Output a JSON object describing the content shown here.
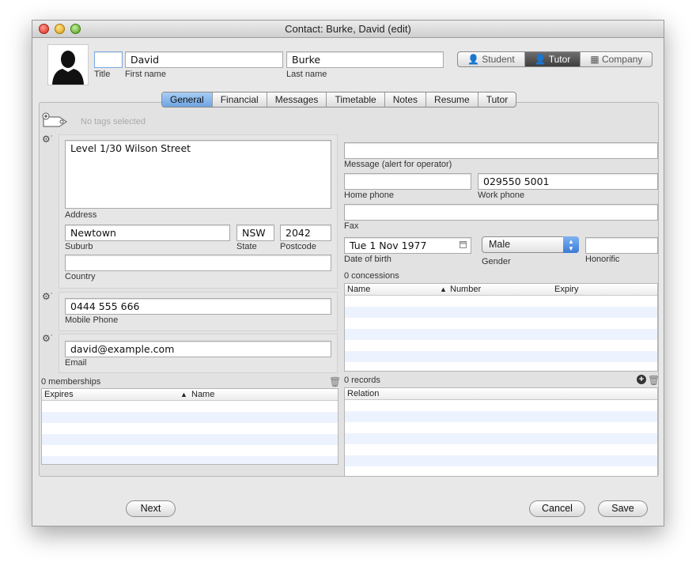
{
  "window": {
    "title": "Contact: Burke, David (edit)"
  },
  "header": {
    "title_value": "",
    "title_label": "Title",
    "first_name_value": "David",
    "first_name_label": "First name",
    "last_name_value": "Burke",
    "last_name_label": "Last name",
    "roles": [
      {
        "label": "Student",
        "active": false
      },
      {
        "label": "Tutor",
        "active": true
      },
      {
        "label": "Company",
        "active": false
      }
    ]
  },
  "tabs": [
    {
      "label": "General",
      "active": true
    },
    {
      "label": "Financial",
      "active": false
    },
    {
      "label": "Messages",
      "active": false
    },
    {
      "label": "Timetable",
      "active": false
    },
    {
      "label": "Notes",
      "active": false
    },
    {
      "label": "Resume",
      "active": false
    },
    {
      "label": "Tutor",
      "active": false
    }
  ],
  "tags": {
    "placeholder": "No tags selected"
  },
  "address": {
    "address_value": "Level 1/30 Wilson Street",
    "address_label": "Address",
    "suburb_value": "Newtown",
    "suburb_label": "Suburb",
    "state_value": "NSW",
    "state_label": "State",
    "postcode_value": "2042",
    "postcode_label": "Postcode",
    "country_value": "",
    "country_label": "Country"
  },
  "mobile": {
    "value": "0444 555 666",
    "label": "Mobile Phone"
  },
  "email": {
    "value": "david@example.com",
    "label": "Email"
  },
  "memberships": {
    "count_label": "0 memberships",
    "columns": [
      "Expires",
      "Name"
    ],
    "sort_indicator": "▲"
  },
  "right": {
    "message_value": "",
    "message_label": "Message (alert for operator)",
    "home_phone_value": "",
    "home_phone_label": "Home phone",
    "work_phone_value": "029550 5001",
    "work_phone_label": "Work phone",
    "fax_value": "",
    "fax_label": "Fax",
    "dob_value": "Tue 1 Nov 1977",
    "dob_label": "Date of birth",
    "gender_value": "Male",
    "gender_label": "Gender",
    "honorific_value": "",
    "honorific_label": "Honorific"
  },
  "concessions": {
    "count_label": "0 concessions",
    "columns": [
      "Name",
      "Number",
      "Expiry"
    ],
    "sort_indicator": "▲"
  },
  "records": {
    "count_label": "0 records",
    "columns": [
      "Relation"
    ]
  },
  "footer": {
    "next": "Next",
    "cancel": "Cancel",
    "save": "Save"
  },
  "colors": {
    "selected_tab": "#6ea4e2",
    "active_role": "#3e3e3e",
    "row_stripe": "#edf3fe"
  }
}
